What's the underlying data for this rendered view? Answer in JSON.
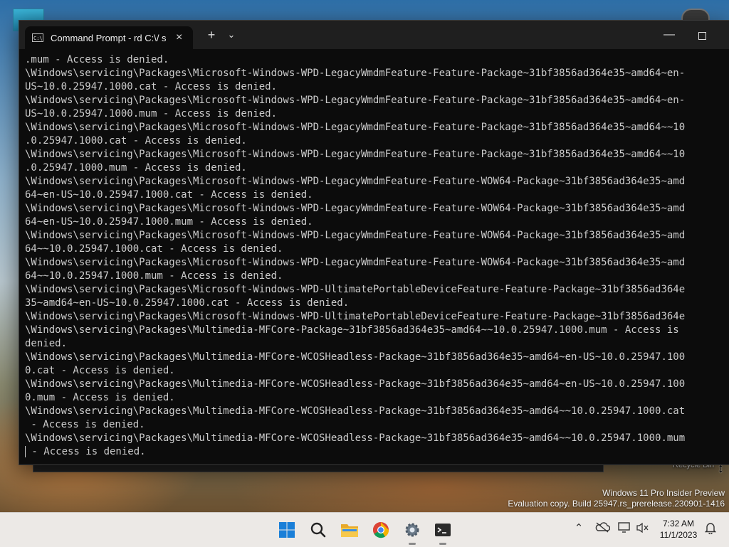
{
  "window": {
    "tab_title": "Command Prompt - rd  C:\\/ s",
    "tab_close": "×",
    "new_tab": "+",
    "dropdown": "⌄",
    "minimize": "—"
  },
  "console_lines": [
    ".mum - Access is denied.",
    "\\Windows\\servicing\\Packages\\Microsoft-Windows-WPD-LegacyWmdmFeature-Feature-Package~31bf3856ad364e35~amd64~en-",
    "US~10.0.25947.1000.cat - Access is denied.",
    "\\Windows\\servicing\\Packages\\Microsoft-Windows-WPD-LegacyWmdmFeature-Feature-Package~31bf3856ad364e35~amd64~en-",
    "US~10.0.25947.1000.mum - Access is denied.",
    "\\Windows\\servicing\\Packages\\Microsoft-Windows-WPD-LegacyWmdmFeature-Feature-Package~31bf3856ad364e35~amd64~~10",
    ".0.25947.1000.cat - Access is denied.",
    "\\Windows\\servicing\\Packages\\Microsoft-Windows-WPD-LegacyWmdmFeature-Feature-Package~31bf3856ad364e35~amd64~~10",
    ".0.25947.1000.mum - Access is denied.",
    "\\Windows\\servicing\\Packages\\Microsoft-Windows-WPD-LegacyWmdmFeature-Feature-WOW64-Package~31bf3856ad364e35~amd",
    "64~en-US~10.0.25947.1000.cat - Access is denied.",
    "\\Windows\\servicing\\Packages\\Microsoft-Windows-WPD-LegacyWmdmFeature-Feature-WOW64-Package~31bf3856ad364e35~amd",
    "64~en-US~10.0.25947.1000.mum - Access is denied.",
    "\\Windows\\servicing\\Packages\\Microsoft-Windows-WPD-LegacyWmdmFeature-Feature-WOW64-Package~31bf3856ad364e35~amd",
    "64~~10.0.25947.1000.cat - Access is denied.",
    "\\Windows\\servicing\\Packages\\Microsoft-Windows-WPD-LegacyWmdmFeature-Feature-WOW64-Package~31bf3856ad364e35~amd",
    "64~~10.0.25947.1000.mum - Access is denied.",
    "\\Windows\\servicing\\Packages\\Microsoft-Windows-WPD-UltimatePortableDeviceFeature-Feature-Package~31bf3856ad364e",
    "35~amd64~en-US~10.0.25947.1000.cat - Access is denied.",
    "\\Windows\\servicing\\Packages\\Microsoft-Windows-WPD-UltimatePortableDeviceFeature-Feature-Package~31bf3856ad364e",
    "\\Windows\\servicing\\Packages\\Multimedia-MFCore-Package~31bf3856ad364e35~amd64~~10.0.25947.1000.mum - Access is",
    "denied.",
    "\\Windows\\servicing\\Packages\\Multimedia-MFCore-WCOSHeadless-Package~31bf3856ad364e35~amd64~en-US~10.0.25947.100",
    "0.cat - Access is denied.",
    "\\Windows\\servicing\\Packages\\Multimedia-MFCore-WCOSHeadless-Package~31bf3856ad364e35~amd64~en-US~10.0.25947.100",
    "0.mum - Access is denied.",
    "\\Windows\\servicing\\Packages\\Multimedia-MFCore-WCOSHeadless-Package~31bf3856ad364e35~amd64~~10.0.25947.1000.cat",
    " - Access is denied.",
    "\\Windows\\servicing\\Packages\\Multimedia-MFCore-WCOSHeadless-Package~31bf3856ad364e35~amd64~~10.0.25947.1000.mum",
    " - Access is denied."
  ],
  "desktop": {
    "recycle_bin_label": "Recycle Bin",
    "watermark_line1": "Windows 11 Pro Insider Preview",
    "watermark_line2": "Evaluation copy. Build 25947.rs_prerelease.230901-1416"
  },
  "taskbar": {
    "apps": [
      "start-icon",
      "search-icon",
      "file-explorer-icon",
      "chrome-icon",
      "settings-icon",
      "terminal-icon"
    ],
    "time": "7:32 AM",
    "date": "11/1/2023"
  },
  "colors": {
    "console_bg": "#0c0c0c",
    "console_fg": "#cccccc",
    "titlebar_bg": "#1f1f1f",
    "taskbar_bg": "#ece9e6",
    "start_blue": "#1a7fd8"
  }
}
